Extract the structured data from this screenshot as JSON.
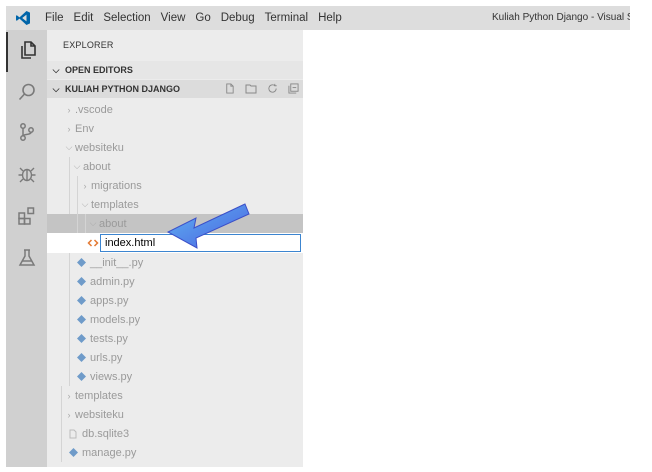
{
  "menu": [
    "File",
    "Edit",
    "Selection",
    "View",
    "Go",
    "Debug",
    "Terminal",
    "Help"
  ],
  "window_title": "Kuliah Python Django - Visual S",
  "explorer": {
    "title": "EXPLORER",
    "open_editors": "OPEN EDITORS",
    "project": "KULIAH PYTHON DJANGO"
  },
  "tree": [
    {
      "label": ".vscode"
    },
    {
      "label": "Env"
    },
    {
      "label": "websiteku"
    },
    {
      "label": "about"
    },
    {
      "label": "migrations"
    },
    {
      "label": "templates"
    },
    {
      "label": "about"
    },
    {
      "label": "__init__.py"
    },
    {
      "label": "admin.py"
    },
    {
      "label": "apps.py"
    },
    {
      "label": "models.py"
    },
    {
      "label": "tests.py"
    },
    {
      "label": "urls.py"
    },
    {
      "label": "views.py"
    },
    {
      "label": "templates"
    },
    {
      "label": "websiteku"
    },
    {
      "label": "db.sqlite3"
    },
    {
      "label": "manage.py"
    }
  ],
  "rename": {
    "value": "index.html"
  },
  "colors": {
    "python_icon": "#6f9bc9",
    "html_icon": "#e37933",
    "arrow": "#4f6fe0",
    "vscode_blue": "#0065a9"
  }
}
